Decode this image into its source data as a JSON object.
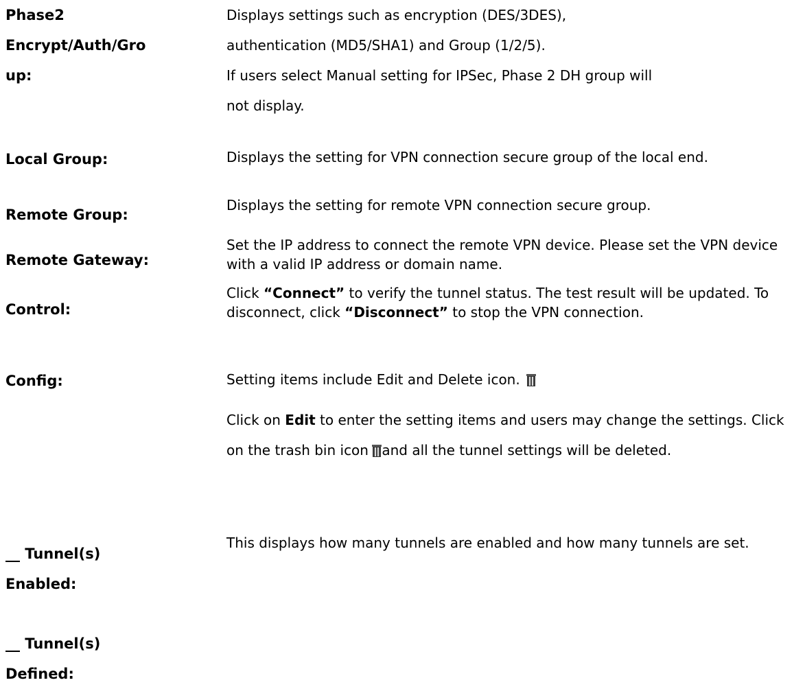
{
  "entries": [
    {
      "term_lines": [
        "Phase2",
        "Encrypt/Auth/Gro",
        "up:"
      ],
      "desc": [
        "Displays settings such as encryption (DES/3DES),",
        "authentication (MD5/SHA1) and Group (1/2/5).",
        "If users select Manual setting for IPSec, Phase 2 DH group will",
        "not display."
      ]
    },
    {
      "term": "Local Group:",
      "desc": "Displays the setting for VPN connection secure group of the local end."
    },
    {
      "term": "Remote Group:",
      "desc": "Displays the setting for remote VPN connection secure group."
    },
    {
      "term": "Remote Gateway:",
      "desc": "Set the IP address to connect the remote VPN device. Please set the VPN device with a valid IP address or domain name."
    },
    {
      "term": "Control:",
      "desc": {
        "pre": "Click ",
        "connect": "“Connect”",
        "mid": " to verify the tunnel status. The test result will be updated. To disconnect, click ",
        "disconnect": "“Disconnect”",
        "post": " to stop the VPN connection."
      }
    },
    {
      "term": "Config:",
      "desc1": "Setting items include Edit and Delete icon.",
      "desc2": {
        "pre": "Click on ",
        "edit": "Edit",
        "mid": " to enter the setting items and users may change the settings. Click on the trash bin icon ",
        "post": "and all the tunnel settings will be deleted."
      }
    },
    {
      "term_lines": [
        "__ Tunnel(s)",
        "Enabled:"
      ],
      "desc": "This displays how many tunnels are enabled and how many tunnels are set."
    },
    {
      "term_lines": [
        "__ Tunnel(s)",
        "Defined:"
      ]
    }
  ],
  "icons": {
    "delete": "trash-bin-icon"
  }
}
